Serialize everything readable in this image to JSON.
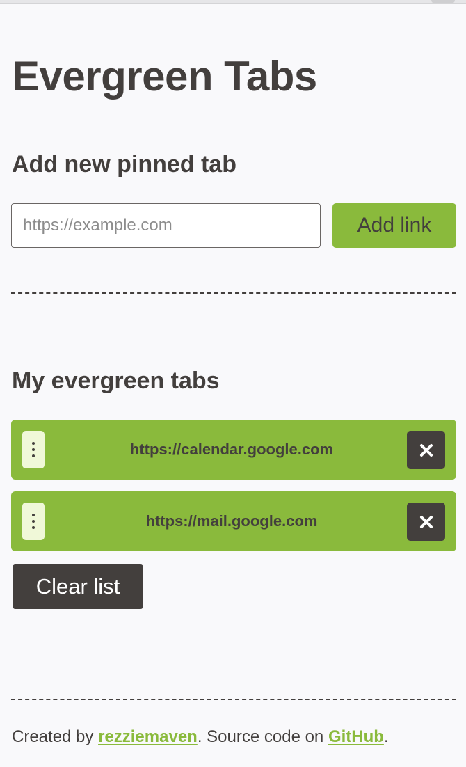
{
  "page": {
    "title": "Evergreen Tabs"
  },
  "add_section": {
    "heading": "Add new pinned tab",
    "input_placeholder": "https://example.com",
    "input_value": "",
    "add_button_label": "Add link"
  },
  "tabs_section": {
    "heading": "My evergreen tabs",
    "tabs": [
      {
        "url": "https://calendar.google.com",
        "drag_icon": "drag-handle-icon",
        "remove_icon": "close-icon"
      },
      {
        "url": "https://mail.google.com",
        "drag_icon": "drag-handle-icon",
        "remove_icon": "close-icon"
      }
    ],
    "clear_button_label": "Clear list"
  },
  "footer": {
    "prefix": "Created by ",
    "author_link": "rezziemaven",
    "middle": ". Source code on ",
    "source_link": "GitHub",
    "suffix": "."
  },
  "colors": {
    "accent_green": "#8aba3c",
    "text_dark": "#433f3d",
    "background": "#f9f9fb",
    "handle_light": "#f0f8d8"
  }
}
